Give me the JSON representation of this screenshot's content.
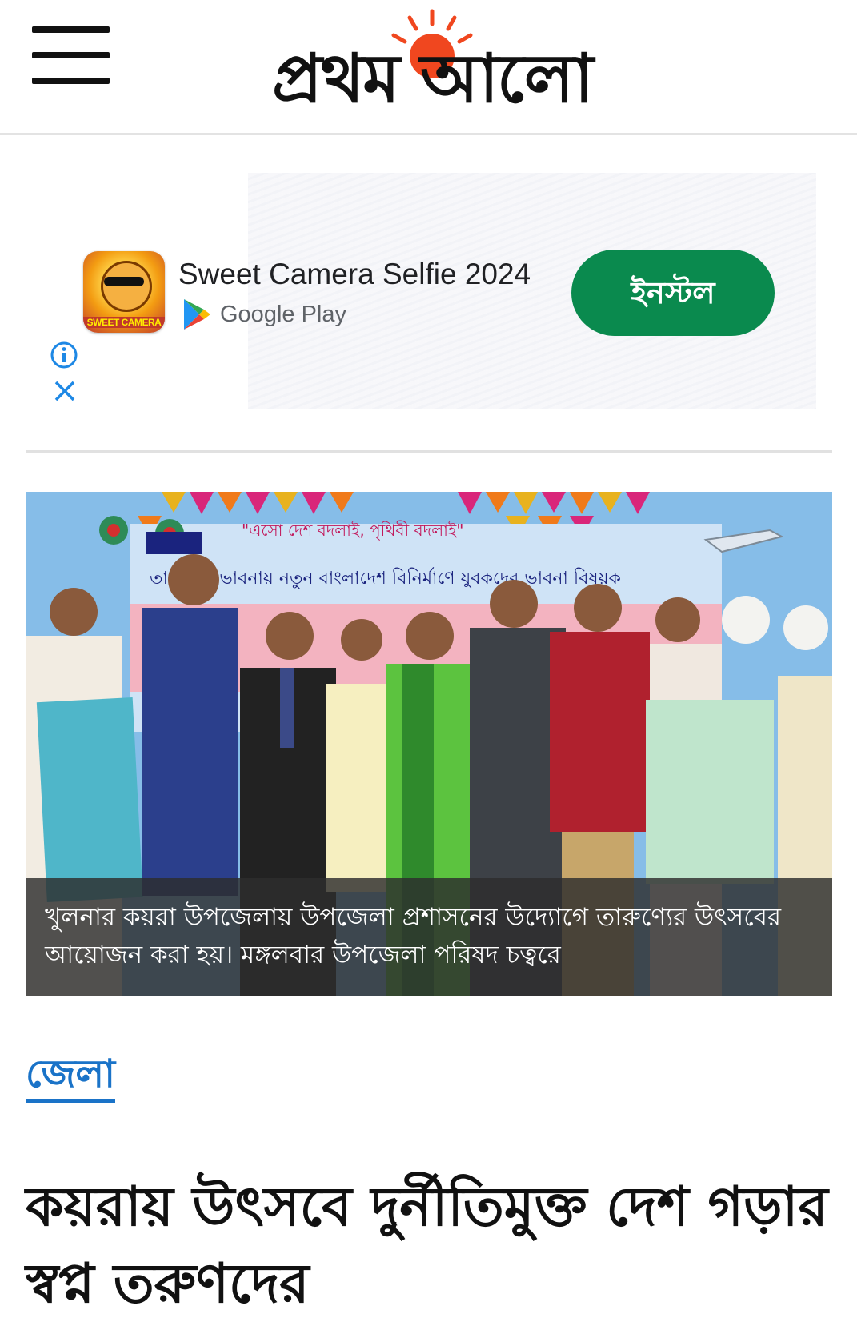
{
  "header": {
    "logo_text": "প্রথম আলো",
    "menu_icon": "hamburger-menu-icon"
  },
  "ad": {
    "app_title": "Sweet Camera Selfie 2024",
    "app_icon_label": "SWEET CAMERA",
    "store_label": "Google Play",
    "install_label": "ইনস্টল",
    "install_color": "#0a8a4e",
    "info_icon": "info-icon",
    "close_icon": "close-icon"
  },
  "hero": {
    "banner_slogan": "\"এসো দেশ বদলাই, পৃথিবী বদলাই\"",
    "banner_line": "তারুণ্যের ভাবনায় নতুন বাংলাদেশ বিনির্মাণে যুবকদের ভাবনা বিষয়ক",
    "caption": "খুলনার কয়রা উপজেলায় উপজেলা প্রশাসনের উদ্যোগে তারুণ্যের উৎসবের আয়োজন করা হয়। মঙ্গলবার উপজেলা পরিষদ চত্বরে"
  },
  "article": {
    "category": "জেলা",
    "category_color": "#1a73c8",
    "headline": "কয়রায় উৎসবে দুর্নীতিমুক্ত দেশ গড়ার স্বপ্ন তরুণদের"
  }
}
